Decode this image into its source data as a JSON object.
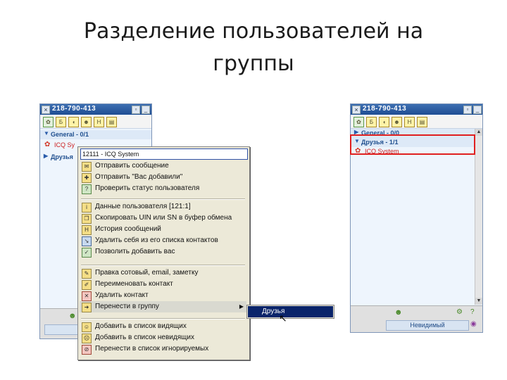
{
  "slide": {
    "title": "Разделение пользователей на группы"
  },
  "left_window": {
    "uin": "218-790-413",
    "toolbar_icons": [
      "flower-icon",
      "settings-icon",
      "sound-icon",
      "avatar-icon",
      "history-icon",
      "note-icon"
    ],
    "groups": [
      {
        "label": "General - 0/1",
        "expanded": true
      },
      {
        "label": "Друзья"
      }
    ],
    "contact": {
      "name": "ICQ Sy"
    },
    "bottom_status_label": "",
    "close_glyph": "×"
  },
  "context_menu": {
    "header": "12111 - ICQ System",
    "items": [
      {
        "label": "Отправить сообщение",
        "icon": "message-icon"
      },
      {
        "label": "Отправить \"Вас добавили\"",
        "icon": "added-icon"
      },
      {
        "label": "Проверить статус пользователя",
        "icon": "status-icon"
      },
      {
        "label": "Данные пользователя [121:1]",
        "icon": "info-icon"
      },
      {
        "label": "Скопировать UIN или SN в буфер обмена",
        "icon": "copy-icon"
      },
      {
        "label": "История сообщений",
        "icon": "history-icon"
      },
      {
        "label": "Удалить себя из его списка контактов",
        "icon": "remove-self-icon"
      },
      {
        "label": "Позволить добавить вас",
        "icon": "allow-icon"
      },
      {
        "label": "Правка сотовый, email, заметку",
        "icon": "edit-icon"
      },
      {
        "label": "Переименовать контакт",
        "icon": "rename-icon"
      },
      {
        "label": "Удалить контакт",
        "icon": "delete-icon"
      },
      {
        "label": "Перенести в группу",
        "icon": "move-icon",
        "highlighted": true,
        "has_submenu": true
      },
      {
        "label": "Добавить в список видящих",
        "icon": "visible-icon"
      },
      {
        "label": "Добавить в список невидящих",
        "icon": "invisible-icon"
      },
      {
        "label": "Перенести в список игнорируемых",
        "icon": "ignore-icon"
      }
    ],
    "submenu_arrow": "▶"
  },
  "submenu": {
    "item": "Друзья"
  },
  "right_window": {
    "uin": "218-790-413",
    "groups": [
      {
        "label": "General - 0/0"
      },
      {
        "label": "Друзья - 1/1",
        "expanded": true
      }
    ],
    "contact": {
      "name": "ICQ System"
    },
    "bottom_status_label": "Невидимый"
  }
}
